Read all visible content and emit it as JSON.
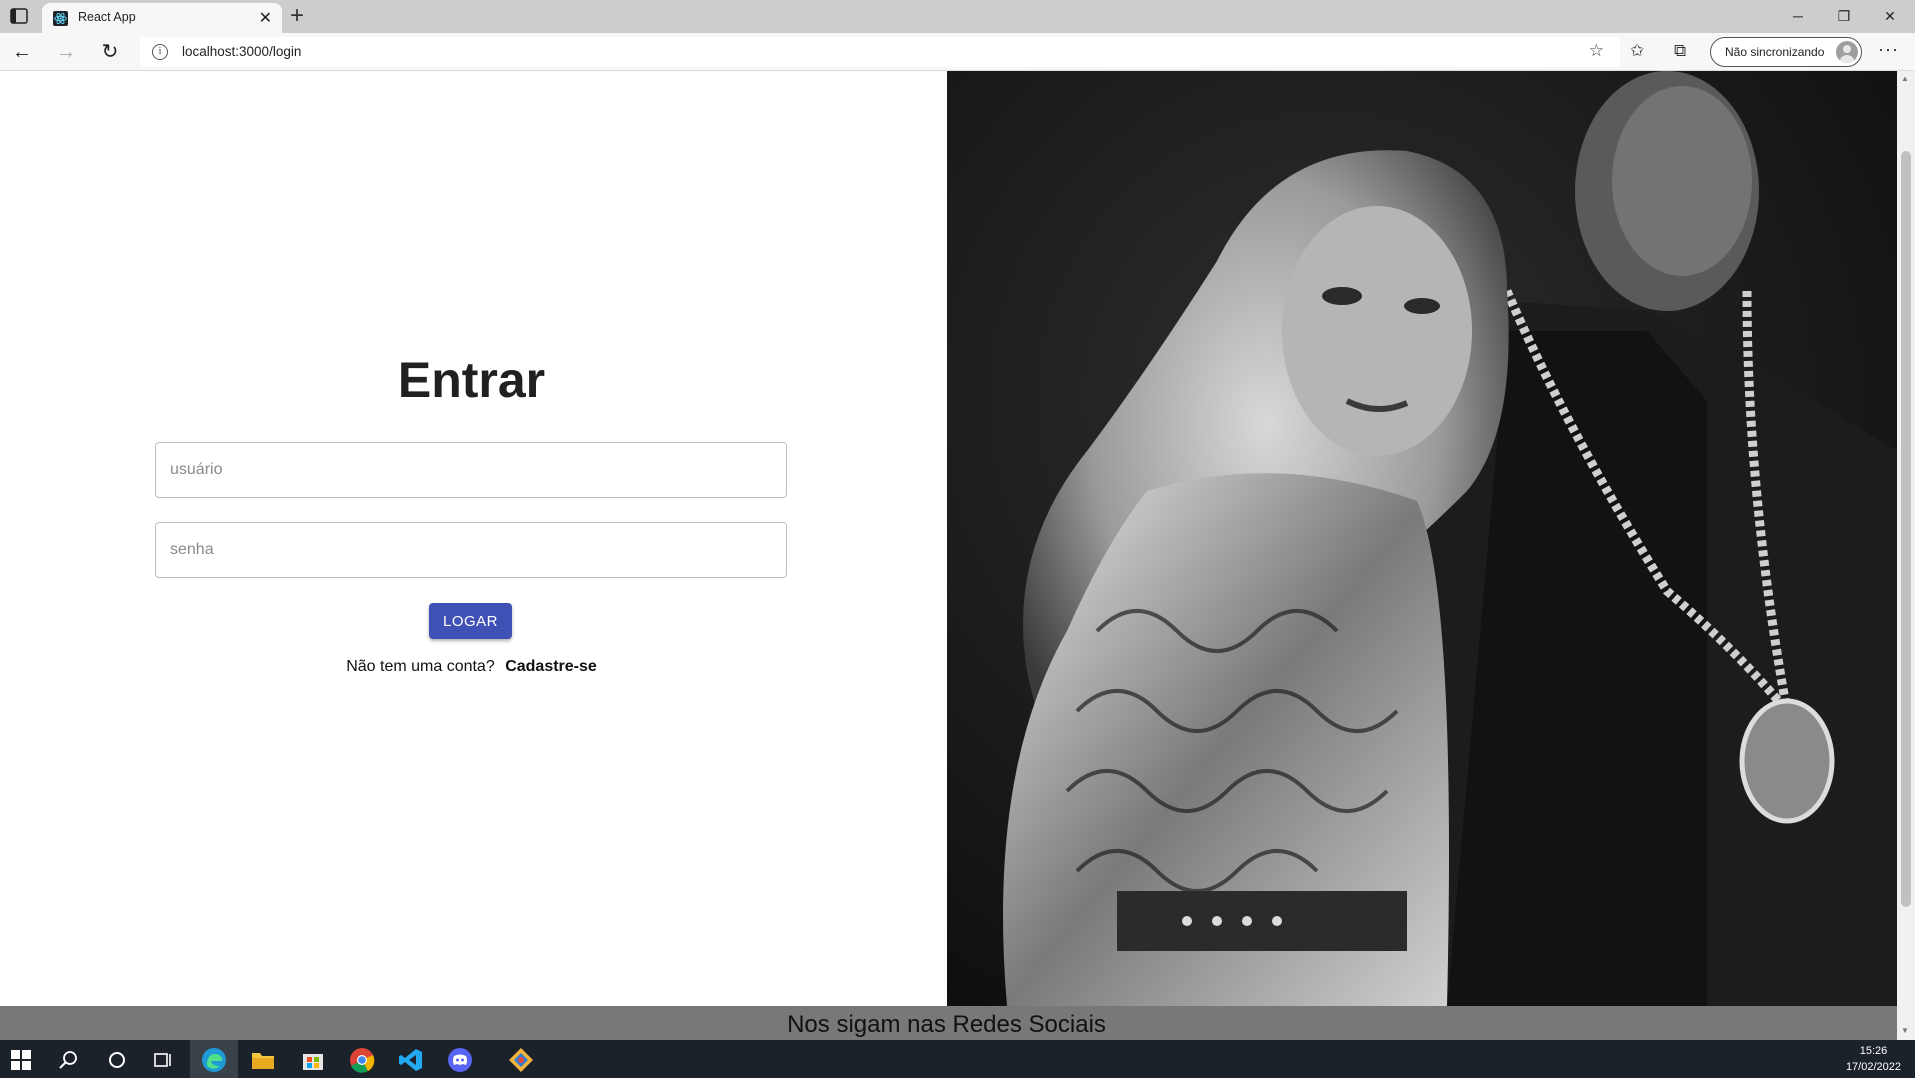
{
  "browser": {
    "tab_title": "React App",
    "tab_close": "✕",
    "new_tab": "+",
    "url": "localhost:3000/login",
    "sync_label": "Não sincronizando",
    "more": "···",
    "window_controls": {
      "minimize": "─",
      "restore": "❐",
      "close": "✕"
    }
  },
  "login": {
    "title": "Entrar",
    "username_placeholder": "usuário",
    "password_placeholder": "senha",
    "submit_label": "LOGAR",
    "no_account_text": "Não tem uma conta?",
    "signup_link": "Cadastre-se"
  },
  "footer": {
    "social_text": "Nos sigam nas Redes Sociais"
  },
  "taskbar": {
    "time": "15:26",
    "date": "17/02/2022"
  },
  "colors": {
    "primary_button": "#3f51b5",
    "footer_bg": "#787878",
    "tabbar_bg": "#cdcdcd",
    "taskbar_bg": "#1b2229"
  }
}
